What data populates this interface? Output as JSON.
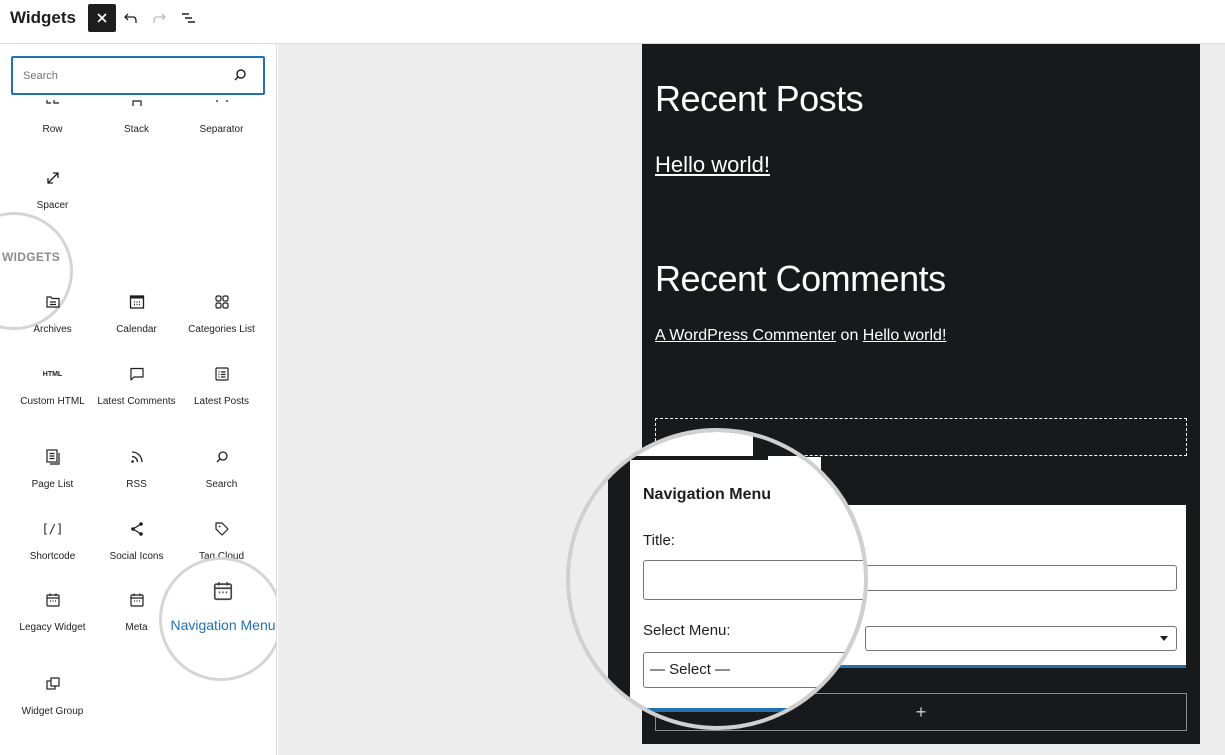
{
  "header": {
    "title": "Widgets",
    "close_label": "×",
    "undo_icon": "undo-icon",
    "redo_icon": "redo-icon",
    "list_view_icon": "list-view-icon"
  },
  "inserter": {
    "search": {
      "placeholder": "Search",
      "value": ""
    },
    "design_blocks": [
      {
        "label": "Row",
        "icon": "row-icon"
      },
      {
        "label": "Stack",
        "icon": "stack-icon"
      },
      {
        "label": "Separator",
        "icon": "separator-icon"
      },
      {
        "label": "Spacer",
        "icon": "spacer-icon"
      }
    ],
    "widgets_section_label": "WIDGETS",
    "widget_blocks": [
      {
        "label": "Archives",
        "icon": "archives-icon"
      },
      {
        "label": "Calendar",
        "icon": "calendar-icon"
      },
      {
        "label": "Categories List",
        "icon": "categories-icon"
      },
      {
        "label": "Custom HTML",
        "icon": "html-icon",
        "glyph": "HTML"
      },
      {
        "label": "Latest Comments",
        "icon": "comment-icon"
      },
      {
        "label": "Latest Posts",
        "icon": "latest-posts-icon"
      },
      {
        "label": "Page List",
        "icon": "page-list-icon"
      },
      {
        "label": "RSS",
        "icon": "rss-icon"
      },
      {
        "label": "Search",
        "icon": "search-icon"
      },
      {
        "label": "Shortcode",
        "icon": "shortcode-icon",
        "glyph": "[/]"
      },
      {
        "label": "Social Icons",
        "icon": "share-icon"
      },
      {
        "label": "Tag Cloud",
        "icon": "tag-icon"
      },
      {
        "label": "Legacy Widget",
        "icon": "legacy-widget-icon"
      },
      {
        "label": "Meta",
        "icon": "meta-icon"
      },
      {
        "label": "Navigation Menu",
        "icon": "navigation-menu-icon",
        "highlighted": true
      },
      {
        "label": "Widget Group",
        "icon": "widget-group-icon"
      }
    ],
    "highlight_color": "#2271b1"
  },
  "canvas": {
    "recent_posts": {
      "title": "Recent Posts",
      "posts": [
        "Hello world!"
      ]
    },
    "recent_comments": {
      "title": "Recent Comments",
      "author": "A WordPress Commenter",
      "connector": "on",
      "post": "Hello world!"
    },
    "navigation_widget": {
      "title": "Navigation Menu",
      "title_label": "Title:",
      "title_value": "",
      "select_label": "Select Menu:",
      "select_value": "— Select —"
    },
    "add_block_label": "+",
    "background_color": "#18191b",
    "accent_color": "#2271b1"
  }
}
